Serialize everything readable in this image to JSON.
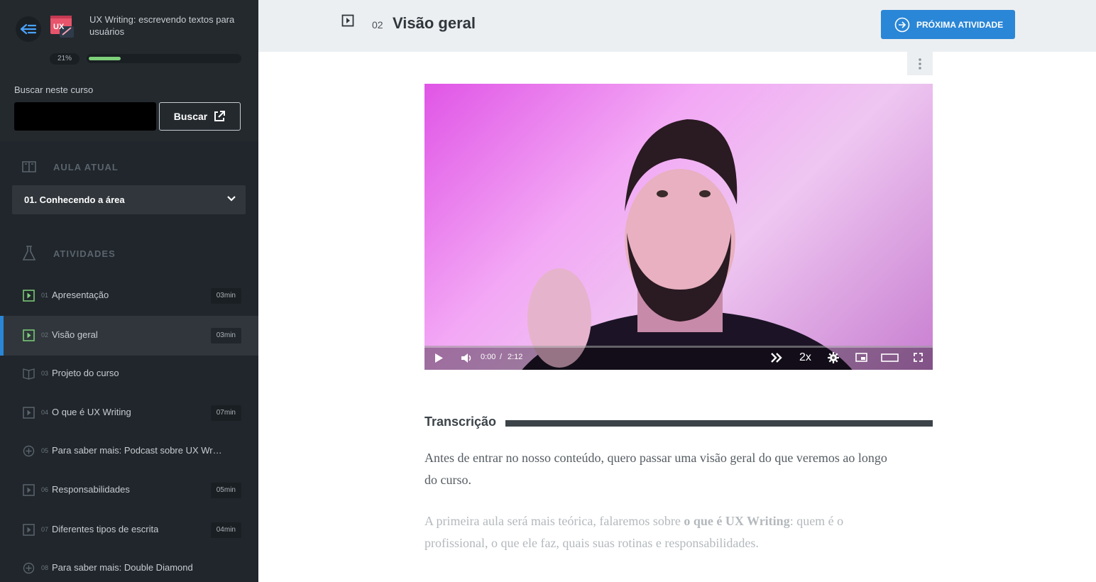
{
  "course": {
    "title": "UX Writing: escrevendo textos para usuários",
    "progress_label": "21%",
    "progress": 0.21,
    "logo_text": "UX"
  },
  "search": {
    "label": "Buscar neste curso",
    "placeholder": "",
    "button_label": "Buscar"
  },
  "current_lesson": {
    "section_label": "AULA ATUAL",
    "selected": "01. Conhecendo a área"
  },
  "activities": {
    "section_label": "ATIVIDADES",
    "items": [
      {
        "num": "01",
        "label": "Apresentação",
        "time": "03min",
        "icon": "video-icon",
        "done": true
      },
      {
        "num": "02",
        "label": "Visão geral",
        "time": "03min",
        "icon": "video-icon",
        "done": true,
        "active": true
      },
      {
        "num": "03",
        "label": "Projeto do curso",
        "time": "",
        "icon": "book-icon"
      },
      {
        "num": "04",
        "label": "O que é UX Writing",
        "time": "07min",
        "icon": "video-icon"
      },
      {
        "num": "05",
        "label": "Para saber mais: Podcast sobre UX Wri...",
        "time": "",
        "icon": "plus-circle-icon"
      },
      {
        "num": "06",
        "label": "Responsabilidades",
        "time": "05min",
        "icon": "video-icon"
      },
      {
        "num": "07",
        "label": "Diferentes tipos de escrita",
        "time": "04min",
        "icon": "video-icon"
      },
      {
        "num": "08",
        "label": "Para saber mais: Double Diamond",
        "time": "",
        "icon": "plus-circle-icon"
      }
    ]
  },
  "header": {
    "num": "02",
    "title": "Visão geral",
    "next_button": "PRÓXIMA ATIVIDADE"
  },
  "video": {
    "current_time": "0:00",
    "separator": "/",
    "duration": "2:12",
    "speed": "2x"
  },
  "transcript": {
    "heading": "Transcrição",
    "p1": "Antes de entrar no nosso conteúdo, quero passar uma visão geral do que veremos ao longo do curso.",
    "p2_pre": "A primeira aula será mais teórica, falaremos sobre ",
    "p2_bold": "o que é UX Writing",
    "p2_post": ": quem é o profissional, o que ele faz, quais suas rotinas e responsabilidades."
  },
  "colors": {
    "accent": "#2a86d6",
    "progress": "#7ed07a",
    "sidebar_bg": "#20262b"
  }
}
